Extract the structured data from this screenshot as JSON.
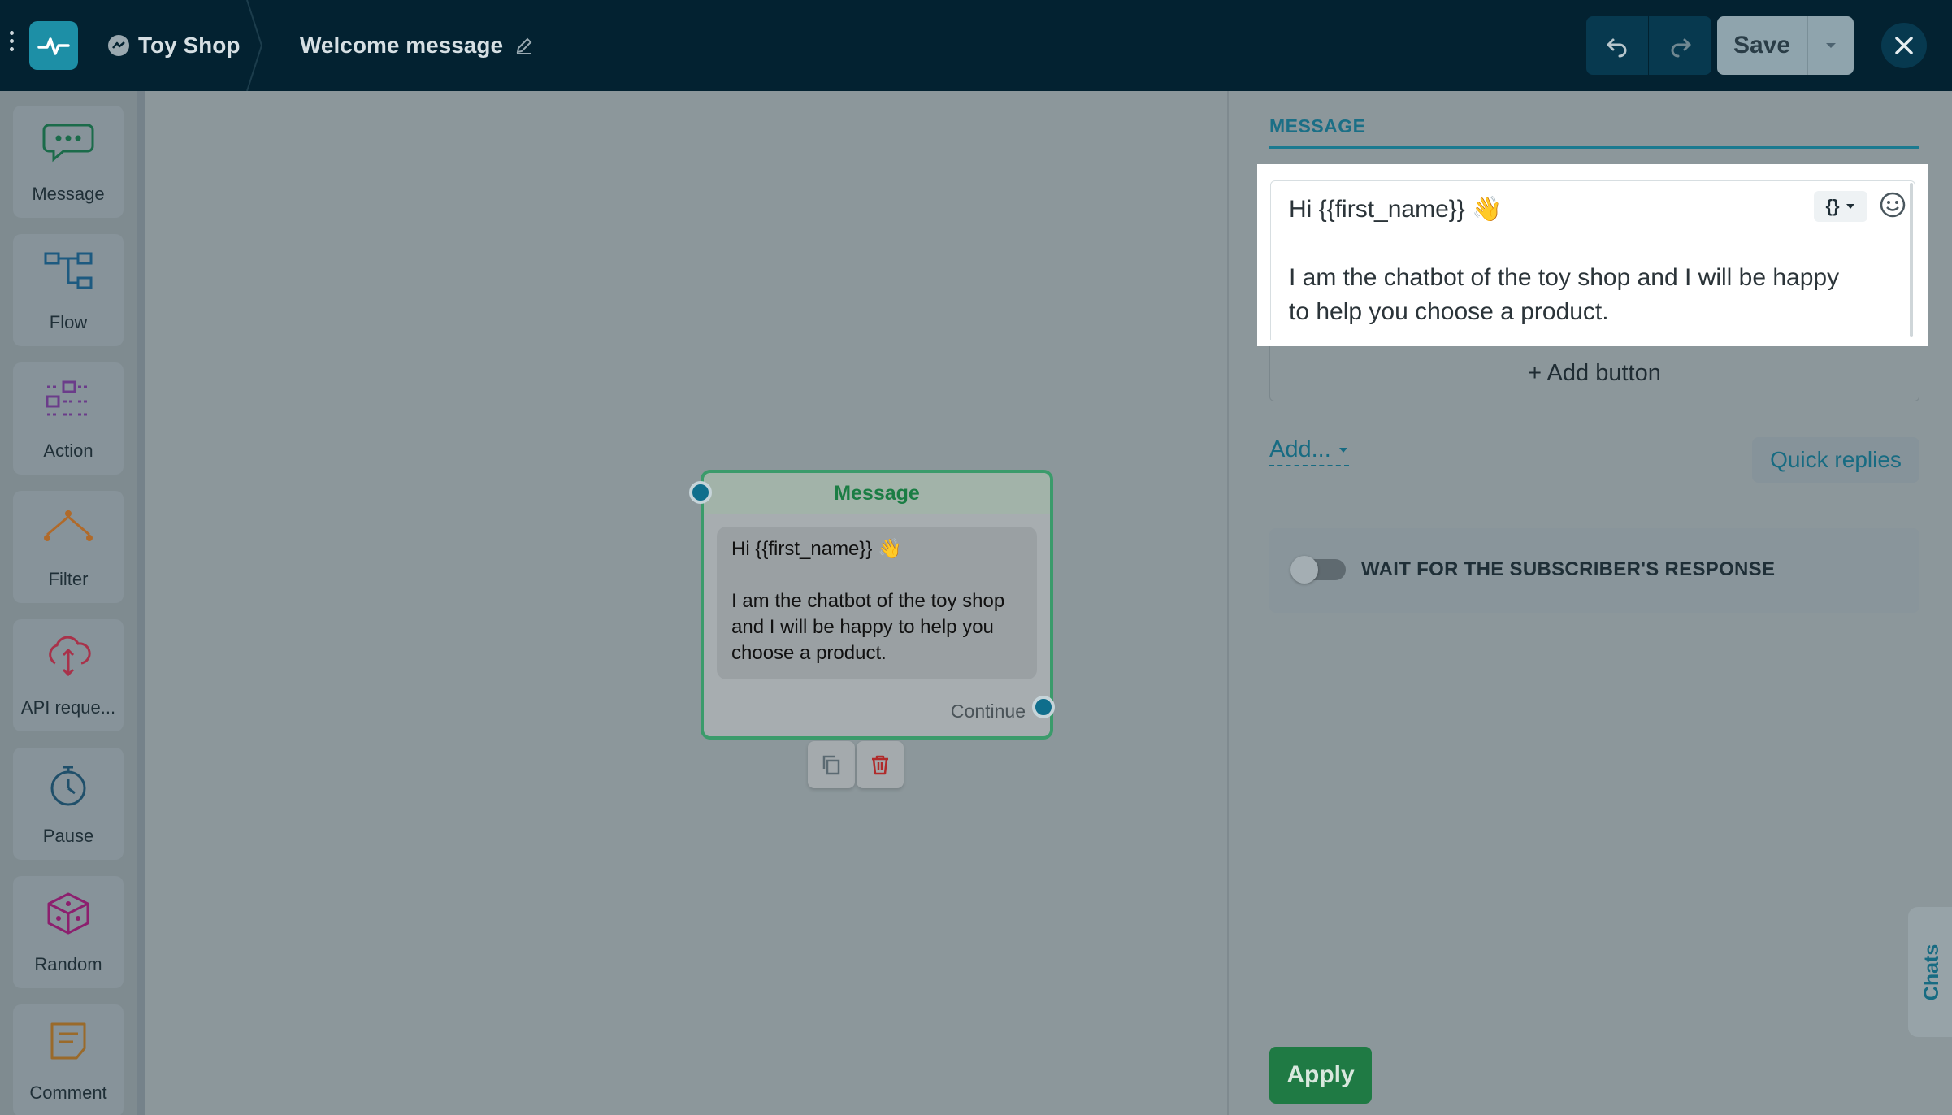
{
  "topbar": {
    "project_name": "Toy Shop",
    "flow_title": "Welcome message",
    "save_label": "Save"
  },
  "sidebar": {
    "tools": [
      {
        "label": "Message",
        "icon": "message-bubble-icon"
      },
      {
        "label": "Flow",
        "icon": "flow-icon"
      },
      {
        "label": "Action",
        "icon": "action-icon"
      },
      {
        "label": "Filter",
        "icon": "filter-icon"
      },
      {
        "label": "API reque...",
        "icon": "api-request-icon"
      },
      {
        "label": "Pause",
        "icon": "timer-icon"
      },
      {
        "label": "Random",
        "icon": "dice-icon"
      },
      {
        "label": "Comment",
        "icon": "comment-icon"
      }
    ]
  },
  "node": {
    "title": "Message",
    "text": "Hi {{first_name}} 👋\n\nI am the chatbot of the toy shop and I will be happy to help you choose a product.",
    "continue_label": "Continue"
  },
  "panel": {
    "tab_label": "MESSAGE",
    "message_text": "Hi {{first_name}} 👋\n\nI am the chatbot of the toy shop and I will be happy to help you choose a product.",
    "variables_label": "{}",
    "add_button_label": "+ Add button",
    "add_menu_label": "Add...",
    "quick_replies_label": "Quick replies",
    "wait_label": "WAIT FOR THE SUBSCRIBER'S RESPONSE",
    "wait_enabled": false,
    "apply_label": "Apply",
    "chats_label": "Chats"
  },
  "colors": {
    "topbar": "#032231",
    "accent": "#1d8fa6",
    "node_border": "#3b9b6b",
    "apply": "#1f7a44"
  }
}
